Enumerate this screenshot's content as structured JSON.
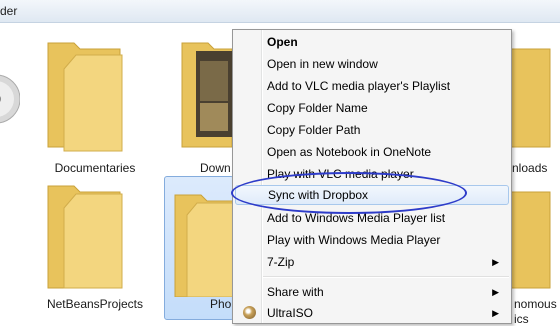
{
  "window": {
    "title": "der"
  },
  "items": {
    "documentaries": "Documentaries",
    "downloads_left": "Down",
    "downloads_right": "nloads",
    "netbeans": "NetBeansProjects",
    "photos": "Pho",
    "right_cut_a": "nomous",
    "right_cut_b": "ics"
  },
  "context_menu": {
    "items": [
      {
        "label": "Open",
        "bold": true
      },
      {
        "label": "Open in new window"
      },
      {
        "label": "Add to VLC media player's Playlist"
      },
      {
        "label": "Copy Folder Name"
      },
      {
        "label": "Copy Folder Path"
      },
      {
        "label": "Open as Notebook in OneNote"
      },
      {
        "label": "Play with VLC media player"
      },
      {
        "label": "Sync with Dropbox",
        "highlighted": true
      },
      {
        "label": "Add to Windows Media Player list"
      },
      {
        "label": "Play with Windows Media Player"
      },
      {
        "label": "7-Zip",
        "submenu": true
      },
      {
        "label": "Share with",
        "submenu": true
      },
      {
        "label": "UltraISO",
        "submenu": true,
        "icon": "ultraiso-icon"
      }
    ],
    "submenu_arrow": "▶"
  },
  "colors": {
    "annotation_ellipse": "#2e3cc9",
    "folder_yellow": "#f1d27a",
    "selection_blue": "#c4ddfa"
  }
}
